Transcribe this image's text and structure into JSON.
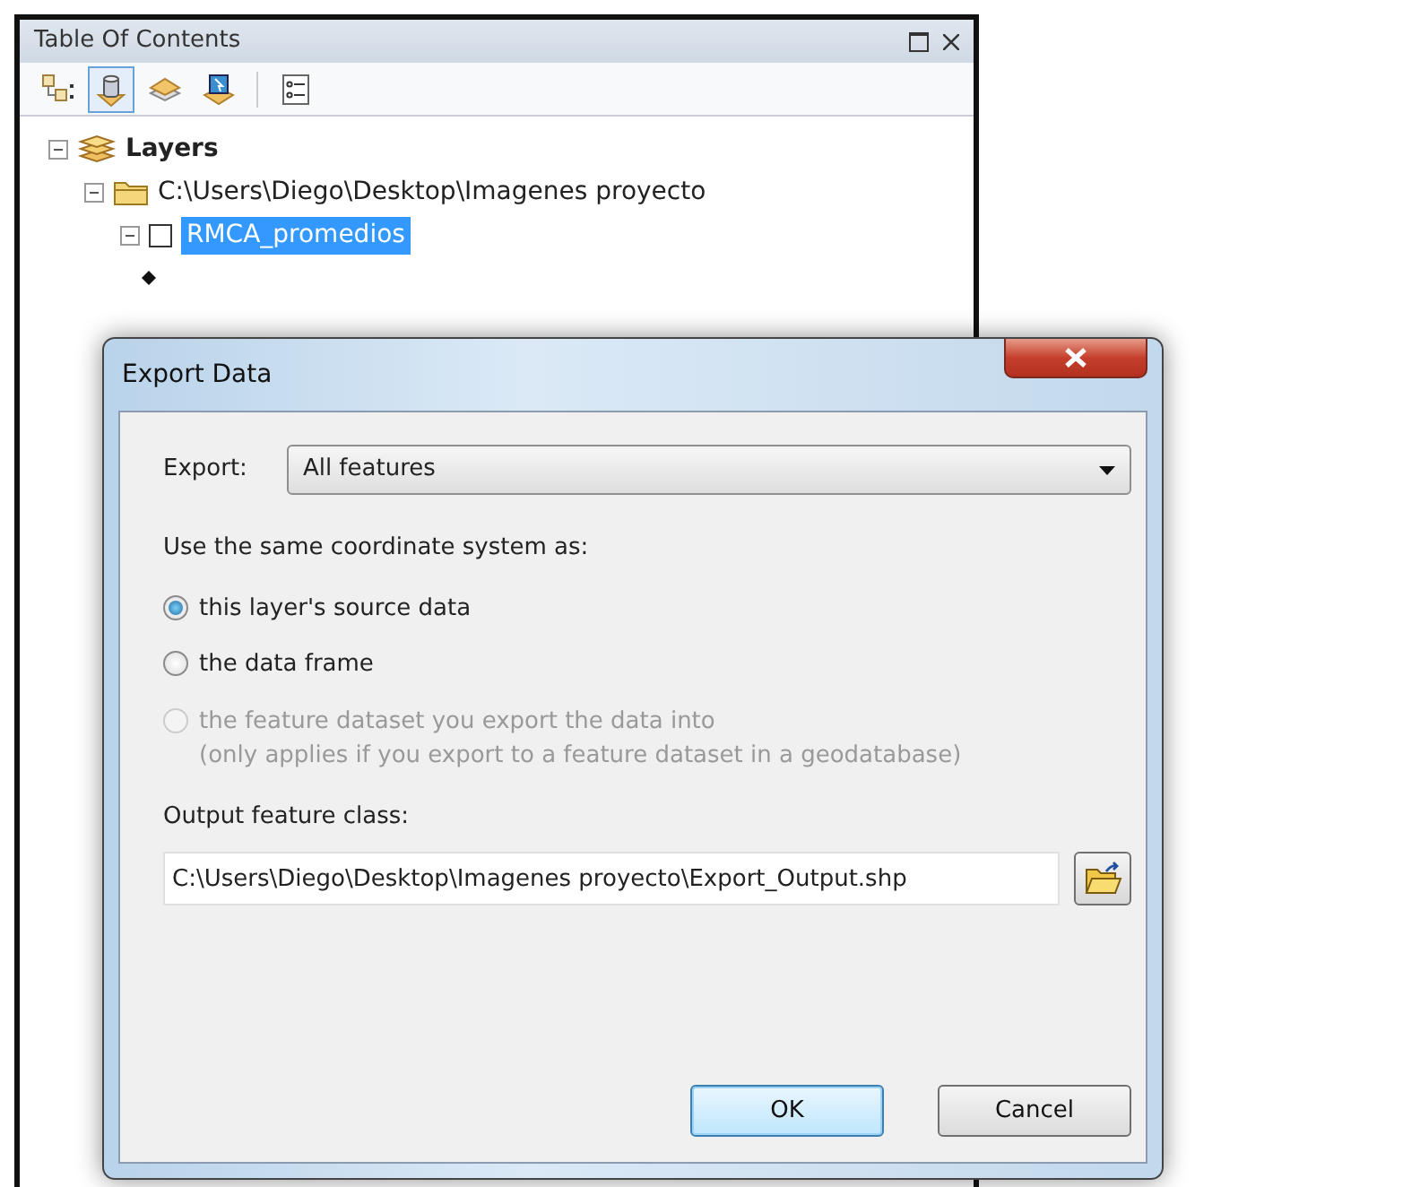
{
  "toc": {
    "title": "Table Of Contents",
    "tools": [
      {
        "kind": "drawing-order",
        "selected": false
      },
      {
        "kind": "source",
        "selected": true
      },
      {
        "kind": "visibility",
        "selected": false
      },
      {
        "kind": "selection",
        "selected": false
      },
      {
        "kind": "options",
        "selected": false
      }
    ],
    "tree": [
      {
        "kind": "group",
        "label": "Layers",
        "expanded": true,
        "children": [
          {
            "kind": "folder",
            "label": "C:\\Users\\Diego\\Desktop\\Imagenes proyecto",
            "expanded": true,
            "children": [
              {
                "kind": "layer",
                "label": "RMCA_promedios",
                "checked": false,
                "selected": true,
                "expanded": true,
                "children": [
                  {
                    "kind": "point-symbol"
                  }
                ]
              }
            ]
          }
        ]
      }
    ]
  },
  "dialog": {
    "title": "Export Data",
    "export_label": "Export:",
    "export_value": "All features",
    "coord_label": "Use the same coordinate system as:",
    "radios": [
      {
        "label": "this layer's source data",
        "selected": true,
        "disabled": false
      },
      {
        "label": "the data frame",
        "selected": false,
        "disabled": false
      },
      {
        "label": "the feature dataset you export the data into",
        "note": "(only applies if you export to a feature dataset in a geodatabase)",
        "selected": false,
        "disabled": true
      }
    ],
    "output_label": "Output feature class:",
    "output_value": "C:\\Users\\Diego\\Desktop\\Imagenes proyecto\\Export_Output.shp",
    "buttons": [
      {
        "label": "OK",
        "default": true
      },
      {
        "label": "Cancel",
        "default": false
      }
    ]
  }
}
